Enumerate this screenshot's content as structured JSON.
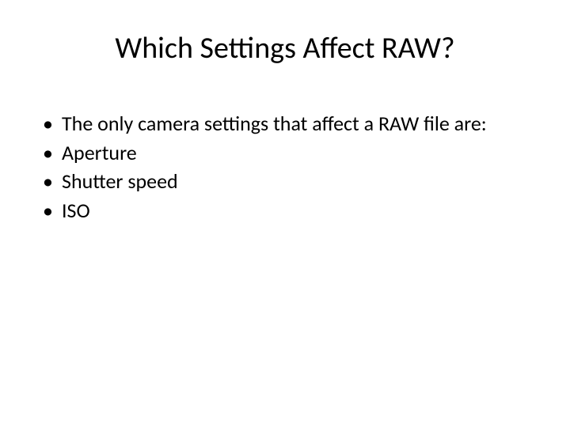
{
  "slide": {
    "title": "Which Settings Affect RAW?",
    "bullets": [
      "The only camera settings that affect a RAW file are:",
      "Aperture",
      "Shutter speed",
      "ISO"
    ]
  }
}
